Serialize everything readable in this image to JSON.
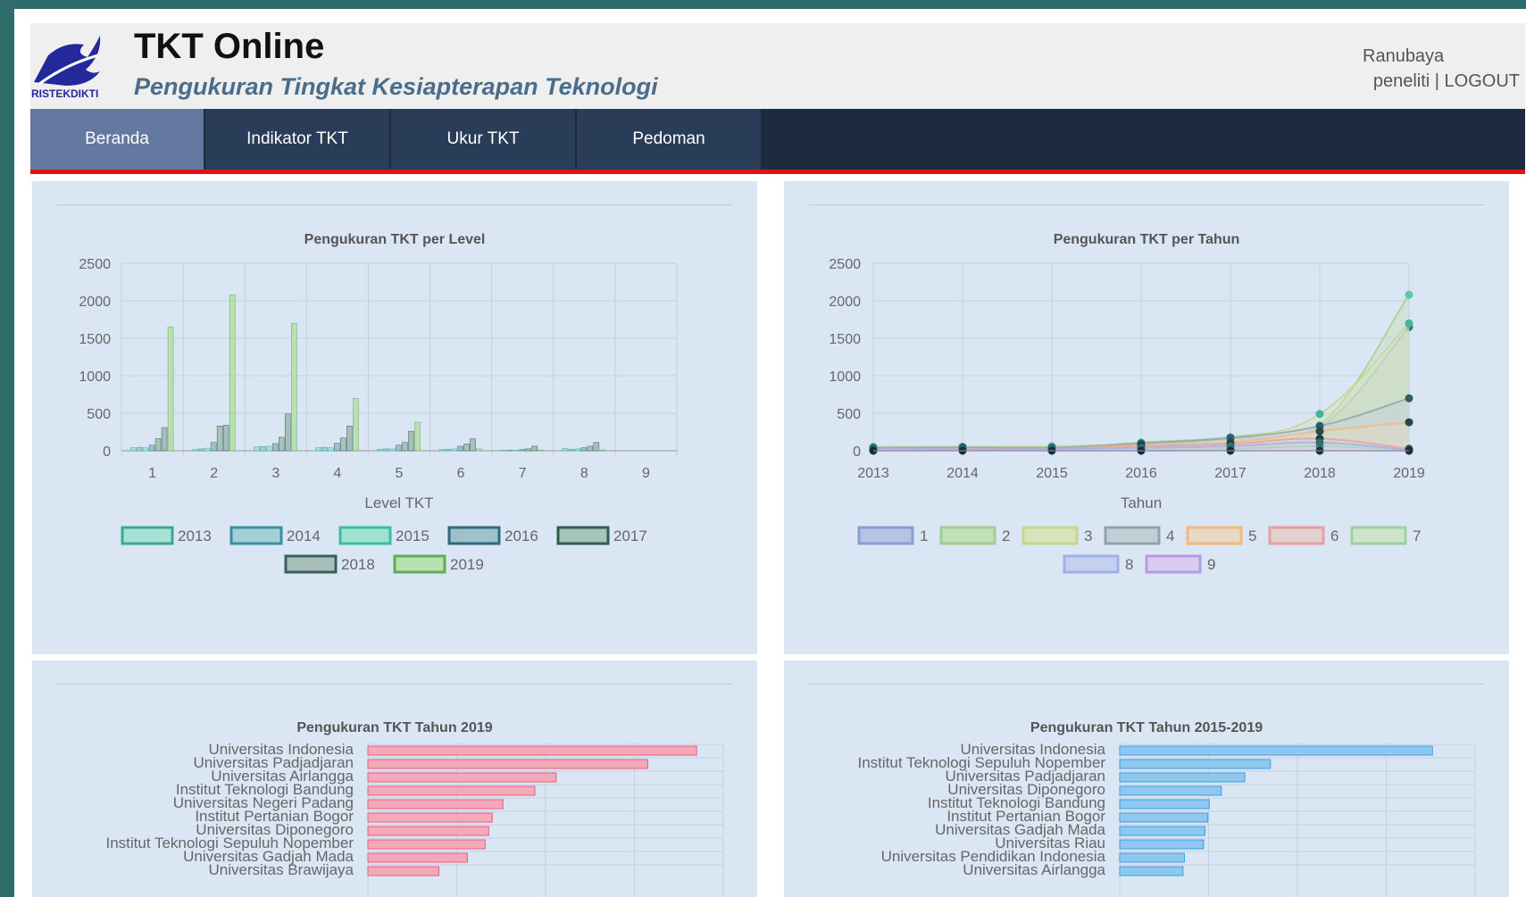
{
  "header": {
    "title": "TKT Online",
    "subtitle": "Pengukuran Tingkat Kesiapterapan Teknologi",
    "logo_text": "RISTEKDIKTI",
    "user_name": "Ranubaya",
    "user_role": "peneliti",
    "separator": "|",
    "logout_label": "LOGOUT"
  },
  "nav": {
    "items": [
      {
        "label": "Beranda",
        "active": true
      },
      {
        "label": "Indikator TKT",
        "active": false
      },
      {
        "label": "Ukur TKT",
        "active": false
      },
      {
        "label": "Pedoman",
        "active": false
      }
    ]
  },
  "colors": {
    "nav_active": "#6479a0",
    "nav_bg": "#1d2b3f",
    "accent_red": "#e01212",
    "panel_bg": "#dbe6f4"
  },
  "chart_data": [
    {
      "type": "bar",
      "title": "Pengukuran TKT per Level",
      "xlabel": "Level TKT",
      "ylabel": "",
      "ylim": [
        0,
        2500
      ],
      "yticks": [
        "0",
        "500",
        "1000",
        "1500",
        "2000",
        "2500"
      ],
      "categories": [
        "1",
        "2",
        "3",
        "4",
        "5",
        "6",
        "7",
        "8",
        "9"
      ],
      "legend_position": "bottom",
      "series": [
        {
          "name": "2013",
          "color": "#a9e0d6",
          "border": "#3aa795",
          "values": [
            40,
            15,
            50,
            40,
            20,
            15,
            5,
            30,
            0
          ]
        },
        {
          "name": "2014",
          "color": "#a3cfd8",
          "border": "#3a8fa3",
          "values": [
            45,
            25,
            55,
            45,
            25,
            20,
            8,
            20,
            0
          ]
        },
        {
          "name": "2015",
          "color": "#9fe2d2",
          "border": "#3bbfa2",
          "values": [
            40,
            35,
            60,
            40,
            25,
            25,
            8,
            25,
            0
          ]
        },
        {
          "name": "2016",
          "color": "#9ebfcc",
          "border": "#2f6b80",
          "values": [
            75,
            110,
            95,
            100,
            75,
            60,
            15,
            40,
            0
          ]
        },
        {
          "name": "2017",
          "color": "#a8c4b8",
          "border": "#2f5e4f",
          "values": [
            160,
            330,
            180,
            170,
            110,
            90,
            25,
            60,
            0
          ]
        },
        {
          "name": "2018",
          "color": "#a6bfbb",
          "border": "#3c5e5a",
          "values": [
            310,
            340,
            490,
            330,
            260,
            160,
            60,
            110,
            0
          ]
        },
        {
          "name": "2019",
          "color": "#b8e0b0",
          "border": "#5fae55",
          "values": [
            1650,
            2080,
            1700,
            700,
            380,
            25,
            10,
            10,
            0
          ]
        }
      ]
    },
    {
      "type": "area",
      "title": "Pengukuran TKT per Tahun",
      "xlabel": "Tahun",
      "ylabel": "",
      "ylim": [
        0,
        2500
      ],
      "yticks": [
        "0",
        "500",
        "1000",
        "1500",
        "2000",
        "2500"
      ],
      "x": [
        "2013",
        "2014",
        "2015",
        "2016",
        "2017",
        "2018",
        "2019"
      ],
      "legend_position": "bottom",
      "series": [
        {
          "name": "1",
          "color": "#b5c4e6",
          "border": "#8b9dd3",
          "values": [
            40,
            45,
            40,
            75,
            160,
            310,
            1650
          ]
        },
        {
          "name": "2",
          "color": "#c3dfb9",
          "border": "#9fd08e",
          "values": [
            15,
            25,
            35,
            110,
            180,
            340,
            2080
          ]
        },
        {
          "name": "3",
          "color": "#d8e3bb",
          "border": "#c7d68e",
          "values": [
            50,
            55,
            60,
            95,
            180,
            490,
            1700
          ]
        },
        {
          "name": "4",
          "color": "#c0cfd6",
          "border": "#8fa4ae",
          "values": [
            40,
            45,
            40,
            100,
            170,
            330,
            700
          ]
        },
        {
          "name": "5",
          "color": "#e7d9c6",
          "border": "#f2b880",
          "values": [
            20,
            25,
            25,
            75,
            110,
            260,
            380
          ]
        },
        {
          "name": "6",
          "color": "#e4cfd0",
          "border": "#e6a0a0",
          "values": [
            15,
            20,
            25,
            60,
            90,
            160,
            25
          ]
        },
        {
          "name": "7",
          "color": "#cce3cc",
          "border": "#9ed09e",
          "values": [
            5,
            8,
            8,
            15,
            25,
            60,
            10
          ]
        },
        {
          "name": "8",
          "color": "#c5d0ee",
          "border": "#9fb0ea",
          "values": [
            30,
            20,
            25,
            40,
            60,
            110,
            10
          ]
        },
        {
          "name": "9",
          "color": "#d8cdee",
          "border": "#b49be6",
          "values": [
            0,
            0,
            0,
            0,
            0,
            0,
            0
          ]
        }
      ]
    },
    {
      "type": "bar",
      "orientation": "horizontal",
      "title": "Pengukuran TKT Tahun 2019",
      "color": "#f3a9ba",
      "border": "#e8607d",
      "categories": [
        "Universitas Indonesia",
        "Universitas Padjadjaran",
        "Universitas Airlangga",
        "Institut Teknologi Bandung",
        "Universitas Negeri Padang",
        "Institut Pertanian Bogor",
        "Universitas Diponegoro",
        "Institut Teknologi Sepuluh Nopember",
        "Universitas Gadjah Mada",
        "Universitas Brawijaya"
      ],
      "values": [
        370,
        315,
        212,
        188,
        152,
        140,
        136,
        132,
        112,
        80
      ],
      "xlim": [
        0,
        400
      ]
    },
    {
      "type": "bar",
      "orientation": "horizontal",
      "title": "Pengukuran TKT Tahun 2015-2019",
      "color": "#8ec7f0",
      "border": "#3a9de3",
      "categories": [
        "Universitas Indonesia",
        "Institut Teknologi Sepuluh Nopember",
        "Universitas Padjadjaran",
        "Universitas Diponegoro",
        "Institut Teknologi Bandung",
        "Institut Pertanian Bogor",
        "Universitas Gadjah Mada",
        "Universitas Riau",
        "Universitas Pendidikan Indonesia",
        "Universitas Airlangga"
      ],
      "values": [
        440,
        212,
        176,
        143,
        126,
        124,
        120,
        118,
        91,
        89
      ],
      "xlim": [
        0,
        500
      ]
    }
  ]
}
